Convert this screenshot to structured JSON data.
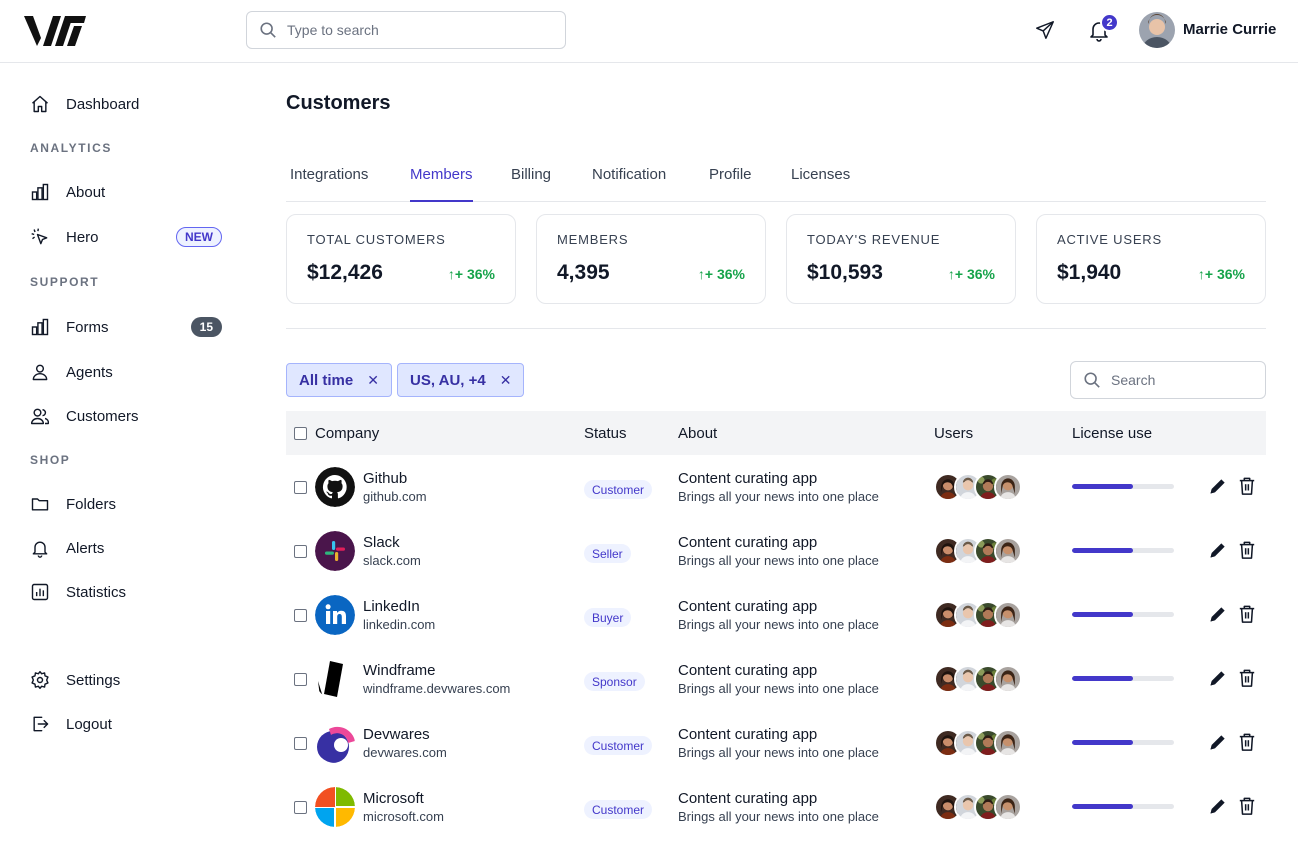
{
  "header": {
    "search_placeholder": "Type to search",
    "notification_count": "2",
    "user_name": "Marrie Currie"
  },
  "sidebar": {
    "dashboard": "Dashboard",
    "section_analytics": "ANALYTICS",
    "about": "About",
    "hero": "Hero",
    "hero_badge": "NEW",
    "section_support": "SUPPORT",
    "forms": "Forms",
    "forms_badge": "15",
    "agents": "Agents",
    "customers": "Customers",
    "section_shop": "SHOP",
    "folders": "Folders",
    "alerts": "Alerts",
    "statistics": "Statistics",
    "settings": "Settings",
    "logout": "Logout"
  },
  "main": {
    "title": "Customers",
    "tabs": [
      {
        "label": "Integrations"
      },
      {
        "label": "Members"
      },
      {
        "label": "Billing"
      },
      {
        "label": "Notification"
      },
      {
        "label": "Profile"
      },
      {
        "label": "Licenses"
      }
    ],
    "active_tab": "Members",
    "stats": [
      {
        "label": "TOTAL CUSTOMERS",
        "value": "$12,426",
        "change": "+ 36%"
      },
      {
        "label": "MEMBERS",
        "value": "4,395",
        "change": "+ 36%"
      },
      {
        "label": "TODAY'S REVENUE",
        "value": "$10,593",
        "change": "+ 36%"
      },
      {
        "label": "ACTIVE USERS",
        "value": "$1,940",
        "change": "+ 36%"
      }
    ],
    "filters": [
      {
        "label": "All time"
      },
      {
        "label": "US, AU, +4"
      }
    ],
    "table_search_placeholder": "Search",
    "columns": {
      "company": "Company",
      "status": "Status",
      "about": "About",
      "users": "Users",
      "license": "License use"
    },
    "rows": [
      {
        "name": "Github",
        "domain": "github.com",
        "status": "Customer",
        "about_title": "Content curating app",
        "about_sub": "Brings all your news into one place",
        "license_fraction": 0.6
      },
      {
        "name": "Slack",
        "domain": "slack.com",
        "status": "Seller",
        "about_title": "Content curating app",
        "about_sub": "Brings all your news into one place",
        "license_fraction": 0.6
      },
      {
        "name": "LinkedIn",
        "domain": "linkedin.com",
        "status": "Buyer",
        "about_title": "Content curating app",
        "about_sub": "Brings all your news into one place",
        "license_fraction": 0.6
      },
      {
        "name": "Windframe",
        "domain": "windframe.devwares.com",
        "status": "Sponsor",
        "about_title": "Content curating app",
        "about_sub": "Brings all your news into one place",
        "license_fraction": 0.6
      },
      {
        "name": "Devwares",
        "domain": "devwares.com",
        "status": "Customer",
        "about_title": "Content curating app",
        "about_sub": "Brings all your news into one place",
        "license_fraction": 0.6
      },
      {
        "name": "Microsoft",
        "domain": "microsoft.com",
        "status": "Customer",
        "about_title": "Content curating app",
        "about_sub": "Brings all your news into one place",
        "license_fraction": 0.6
      }
    ]
  },
  "colors": {
    "accent": "#4338ca",
    "positive": "#16a34a",
    "chip_bg": "#e0e7ff"
  },
  "icons": {
    "logo": "brand-logo",
    "send": "paper-plane-icon",
    "bell": "bell-icon",
    "edit": "pencil-icon",
    "delete": "trash-icon"
  }
}
